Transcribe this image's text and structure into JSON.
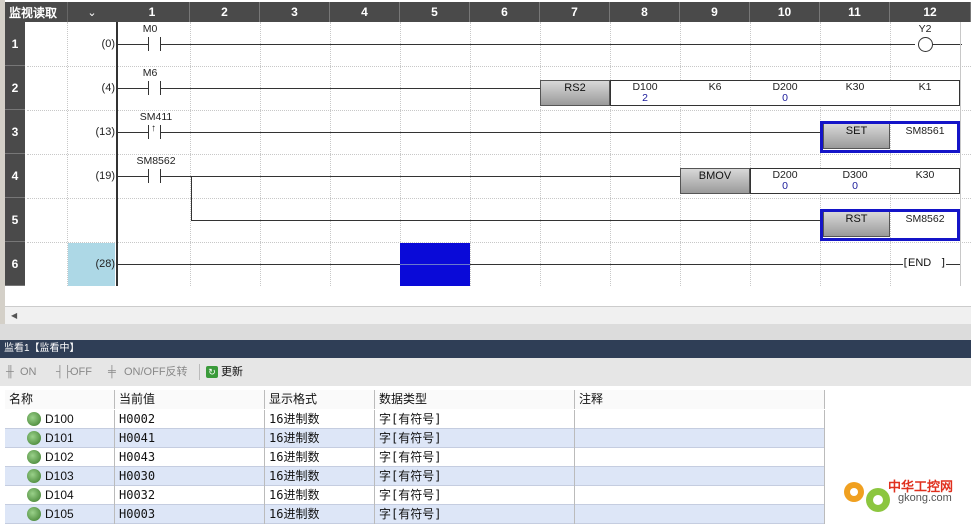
{
  "ladder": {
    "mode_label": "监视读取",
    "mode_dropdown": "⌄",
    "columns": [
      "1",
      "2",
      "3",
      "4",
      "5",
      "6",
      "7",
      "8",
      "9",
      "10",
      "11",
      "12"
    ],
    "rows": [
      {
        "num": "1",
        "step": "(0)"
      },
      {
        "num": "2",
        "step": "(4)"
      },
      {
        "num": "3",
        "step": "(13)"
      },
      {
        "num": "4",
        "step": "(19)"
      },
      {
        "num": "5",
        "step": ""
      },
      {
        "num": "6",
        "step": "(28)"
      }
    ],
    "contacts": {
      "r1": "M0",
      "r2": "M6",
      "r3": "SM411",
      "r4": "SM8562"
    },
    "coil_r1": "Y2",
    "r2_inst": {
      "name": "RS2",
      "op1": "D100",
      "op1_val": "2",
      "op2": "K6",
      "op3": "D200",
      "op3_val": "0",
      "op4": "K30",
      "op5": "K1"
    },
    "r3_inst": {
      "name": "SET",
      "op": "SM8561"
    },
    "r4_inst": {
      "name": "BMOV",
      "op1": "D200",
      "op1_val": "0",
      "op2": "D300",
      "op2_val": "0",
      "op3": "K30"
    },
    "r5_inst": {
      "name": "RST",
      "op": "SM8562"
    },
    "end_label": "END"
  },
  "watch": {
    "title": "监看1【监看中】",
    "toolbar": {
      "on": "ON",
      "off": "OFF",
      "toggle": "ON/OFF反转",
      "update": "更新"
    },
    "headers": [
      "名称",
      "当前值",
      "显示格式",
      "数据类型",
      "注释"
    ],
    "rows": [
      {
        "name": "D100",
        "value": "H0002",
        "format": "16进制数",
        "type": "字[有符号]",
        "comment": ""
      },
      {
        "name": "D101",
        "value": "H0041",
        "format": "16进制数",
        "type": "字[有符号]",
        "comment": ""
      },
      {
        "name": "D102",
        "value": "H0043",
        "format": "16进制数",
        "type": "字[有符号]",
        "comment": ""
      },
      {
        "name": "D103",
        "value": "H0030",
        "format": "16进制数",
        "type": "字[有符号]",
        "comment": ""
      },
      {
        "name": "D104",
        "value": "H0032",
        "format": "16进制数",
        "type": "字[有符号]",
        "comment": ""
      },
      {
        "name": "D105",
        "value": "H0003",
        "format": "16进制数",
        "type": "字[有符号]",
        "comment": ""
      }
    ]
  },
  "watermark": {
    "cn": "中华工控网",
    "url": "gkong.com"
  },
  "colors": {
    "select_blue": "#1414c8",
    "cursor_blue": "#0a0ad8",
    "step_highlight": "#add8e6",
    "header_dark": "#4a4a4a"
  }
}
